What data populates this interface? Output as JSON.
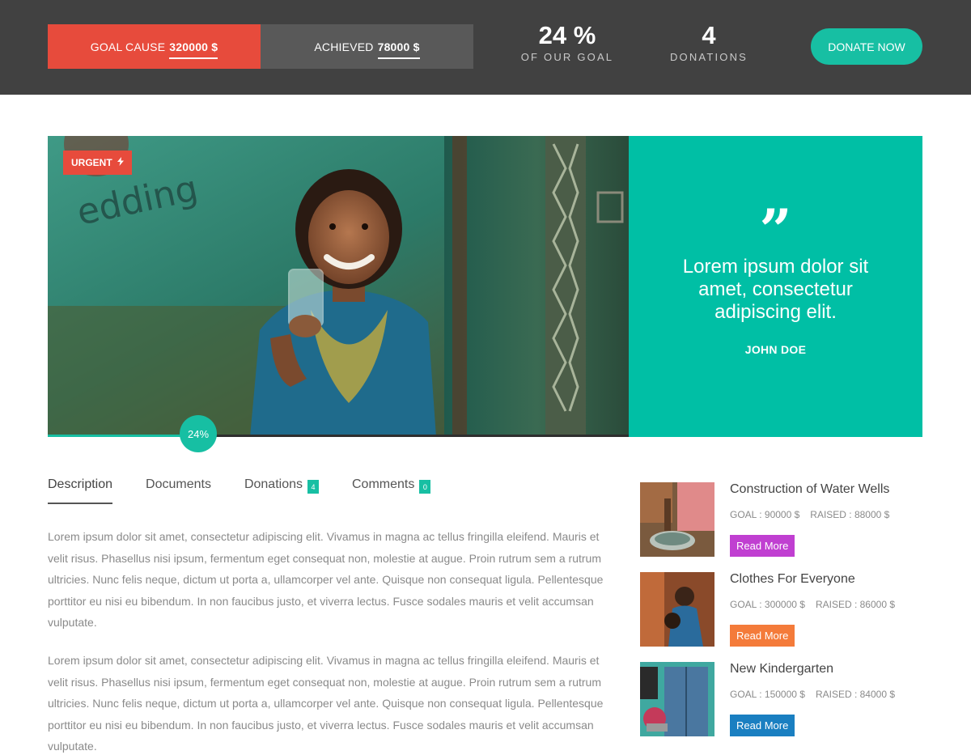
{
  "colors": {
    "topbar": "#414141",
    "accent": "#17bfa3",
    "urgent": "#e74b3c",
    "teal_panel": "#00bfa5"
  },
  "topbar": {
    "goal_label": "GOAL CAUSE",
    "goal_value": "320000 $",
    "achieved_label": "ACHIEVED",
    "achieved_value": "78000 $",
    "percent_value": "24 %",
    "percent_label": "OF OUR GOAL",
    "donations_value": "4",
    "donations_label": "DONATIONS",
    "donate_button": "DONATE NOW"
  },
  "hero": {
    "badge": "URGENT",
    "badge_icon": "lightning-icon",
    "quote_mark": "”",
    "quote": "Lorem ipsum dolor sit amet, consectetur adipiscing elit.",
    "author": "JOHN DOE",
    "progress_fraction": 0.24,
    "progress_label": "24%"
  },
  "tabs": [
    {
      "label": "Description",
      "count": null
    },
    {
      "label": "Documents",
      "count": null
    },
    {
      "label": "Donations",
      "count": "4"
    },
    {
      "label": "Comments",
      "count": "0"
    }
  ],
  "description": {
    "p1": "Lorem ipsum dolor sit amet, consectetur adipiscing elit. Vivamus in magna ac tellus fringilla eleifend. Mauris et velit risus. Phasellus nisi ipsum, fermentum eget consequat non, molestie at augue. Proin rutrum sem a rutrum ultricies. Nunc felis neque, dictum ut porta a, ullamcorper vel ante. Quisque non consequat ligula. Pellentesque porttitor eu nisi eu bibendum. In non faucibus justo, et viverra lectus. Fusce sodales mauris et velit accumsan vulputate.",
    "p2": "Lorem ipsum dolor sit amet, consectetur adipiscing elit. Vivamus in magna ac tellus fringilla eleifend. Mauris et velit risus. Phasellus nisi ipsum, fermentum eget consequat non, molestie at augue. Proin rutrum sem a rutrum ultricies. Nunc felis neque, dictum ut porta a, ullamcorper vel ante. Quisque non consequat ligula. Pellentesque porttitor eu nisi eu bibendum. In non faucibus justo, et viverra lectus. Fusce sodales mauris et velit accumsan vulputate."
  },
  "causes": [
    {
      "title": "Construction of Water Wells",
      "goal": "GOAL : 90000 $",
      "raised": "RAISED : 88000 $",
      "button": "Read More",
      "button_color": "#c03fd1"
    },
    {
      "title": "Clothes For Everyone",
      "goal": "GOAL : 300000 $",
      "raised": "RAISED : 86000 $",
      "button": "Read More",
      "button_color": "#f47b3a"
    },
    {
      "title": "New Kindergarten",
      "goal": "GOAL : 150000 $",
      "raised": "RAISED : 84000 $",
      "button": "Read More",
      "button_color": "#1a7fc1"
    }
  ]
}
